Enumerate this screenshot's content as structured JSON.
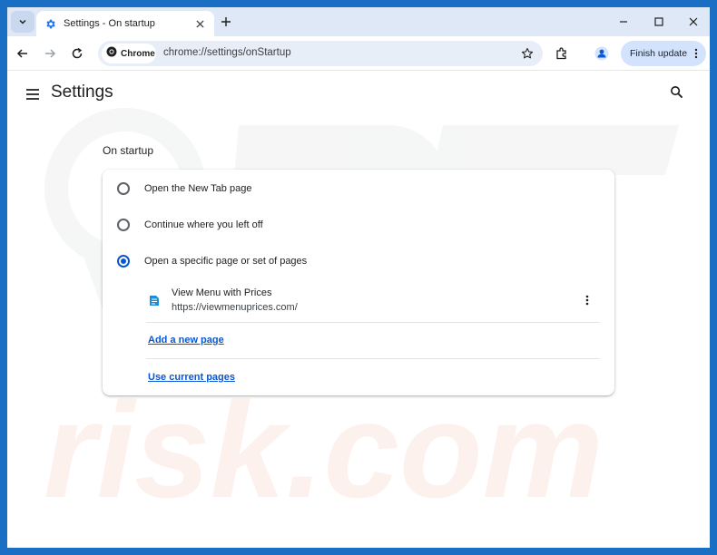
{
  "tab": {
    "title": "Settings - On startup"
  },
  "toolbar": {
    "chip_label": "Chrome",
    "url": "chrome://settings/onStartup",
    "finish_update_label": "Finish update"
  },
  "settings": {
    "title": "Settings",
    "section_label": "On startup",
    "options": [
      {
        "label": "Open the New Tab page",
        "checked": false
      },
      {
        "label": "Continue where you left off",
        "checked": false
      },
      {
        "label": "Open a specific page or set of pages",
        "checked": true
      }
    ],
    "startup_page": {
      "name": "View Menu with Prices",
      "url": "https://viewmenuprices.com/"
    },
    "add_page_link": "Add a new page",
    "use_current_link": "Use current pages"
  },
  "watermark": {
    "text": "risk.com"
  },
  "colors": {
    "frame": "#1a6fc4",
    "tabstrip": "#dfe8f7",
    "accent": "#0b57d0",
    "omnibox": "#e8eef8",
    "update_button": "#d3e3fd"
  },
  "icons": [
    "tab-search-icon",
    "settings-gear-icon",
    "close-icon",
    "plus-icon",
    "minimize-icon",
    "maximize-icon",
    "back-icon",
    "forward-icon",
    "reload-icon",
    "chrome-icon",
    "star-icon",
    "extensions-icon",
    "profile-icon",
    "more-vert-icon",
    "hamburger-icon",
    "search-icon",
    "page-favicon-icon"
  ]
}
